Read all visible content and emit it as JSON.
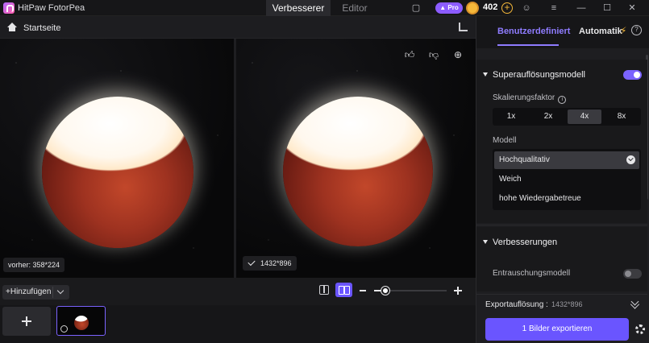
{
  "app": {
    "title": "HitPaw FotorPea",
    "tabs": [
      {
        "label": "Verbesserer",
        "active": true
      },
      {
        "label": "Editor",
        "active": false
      }
    ],
    "pro_label": "Pro",
    "coins": "402"
  },
  "breadcrumb": {
    "label": "Startseite"
  },
  "canvas": {
    "before_label": "vorher: 358*224",
    "after_label": "1432*896"
  },
  "toolbar": {
    "add_label": "Hinzufügen",
    "zoom_fraction": 0.15
  },
  "sidebar": {
    "tabs": [
      {
        "label": "Benutzerdefiniert",
        "active": true
      },
      {
        "label": "Automatik",
        "active": false
      }
    ],
    "superres": {
      "title": "Superauflösungsmodell",
      "enabled": true,
      "scale_label": "Skalierungsfaktor",
      "scales": [
        "1x",
        "2x",
        "4x",
        "8x"
      ],
      "selected_scale": "4x",
      "model_label": "Modell",
      "models": [
        "Hochqualitativ",
        "Weich",
        "hohe Wiedergabetreue"
      ],
      "selected_model": "Hochqualitativ"
    },
    "enhancements": {
      "title": "Verbesserungen",
      "denoise_label": "Entrauschungsmodell",
      "denoise_enabled": false
    },
    "export": {
      "resolution_label": "Exportauflösung :",
      "resolution_value": "1432*896",
      "button_label": "1 Bilder exportieren"
    }
  },
  "colors": {
    "accent": "#6a55ff",
    "accent_text": "#8f7cff",
    "coin": "#f5b83a"
  }
}
